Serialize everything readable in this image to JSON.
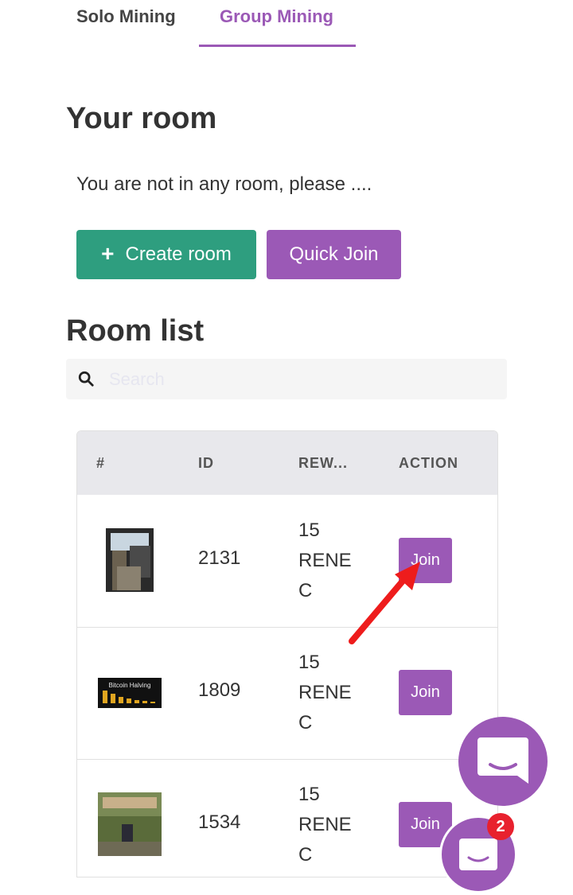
{
  "tabs": [
    {
      "label": "Solo Mining",
      "active": false
    },
    {
      "label": "Group Mining",
      "active": true
    }
  ],
  "your_room": {
    "heading": "Your room",
    "message": "You are not in any room, please ....",
    "create_label": "Create room",
    "quick_join_label": "Quick Join"
  },
  "room_list": {
    "heading": "Room list",
    "search_placeholder": "Search",
    "columns": [
      "#",
      "ID",
      "REW...",
      "ACTION"
    ],
    "rows": [
      {
        "id": "2131",
        "reward_lines": [
          "15",
          "RENE",
          "C"
        ],
        "action": "Join"
      },
      {
        "id": "1809",
        "reward_lines": [
          "15",
          "RENE",
          "C"
        ],
        "action": "Join"
      },
      {
        "id": "1534",
        "reward_lines": [
          "15",
          "RENE",
          "C"
        ],
        "action": "Join"
      }
    ]
  },
  "thumbnail_text": {
    "bitcoin_halving": "Bitcoin Halving"
  },
  "chat": {
    "badge_count": "2"
  },
  "colors": {
    "accent": "#9b59b6",
    "create": "#2e9e7f",
    "badge": "#e8212e",
    "arrow": "#ee1c1c"
  },
  "icons": [
    "search-icon",
    "plus-icon",
    "chat-icon",
    "arrow-icon"
  ]
}
